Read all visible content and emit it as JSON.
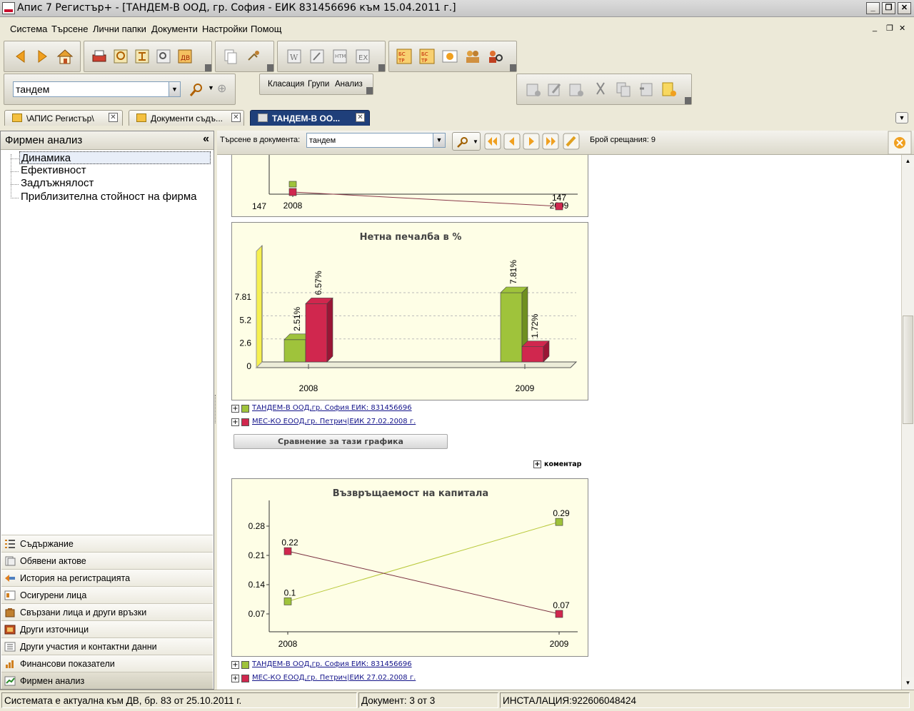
{
  "window": {
    "title": "Апис 7 Регистър+ - [ТАНДЕМ-В ООД, гр. София - ЕИК 831456696 към  15.04.2011 г.]"
  },
  "menu": [
    "Система",
    "Търсене",
    "Лични папки",
    "Документи",
    "Настройки",
    "Помощ"
  ],
  "toolbar": {
    "search_value": "тандем",
    "group_buttons": [
      "Класация",
      "Групи",
      "Анализ"
    ]
  },
  "tabs": [
    {
      "label": "\\АПИС Регистър\\"
    },
    {
      "label": "Документи съдъ..."
    },
    {
      "label": "ТАНДЕМ-В ОО..."
    }
  ],
  "left_panel": {
    "title": "Фирмен анализ",
    "collapse": "«",
    "tree": [
      "Динамика",
      "Ефективност",
      "Задлъжнялост",
      "Приблизителна стойност на фирма"
    ],
    "nav": [
      "Съдържание",
      "Обявени актове",
      "История на регистрацията",
      "Осигурени лица",
      "Свързани лица и други връзки",
      "Други източници",
      "Други участия и контактни данни",
      "Финансови показатели",
      "Фирмен анализ"
    ]
  },
  "searchbar": {
    "label": "Търсене в документа:",
    "value": "тандем",
    "count_label": "Брой срещания: 9"
  },
  "legend": {
    "series1": "ТАНДЕМ-В ООД,гр. София ЕИК: 831456696",
    "series2": "МЕС-КО ЕООД,гр. Петрич|ЕИК 27.02.2008 г.",
    "compare_button": "Сравнение за тази графика",
    "comment": "коментар"
  },
  "colors": {
    "series1": "#9fc33b",
    "series2": "#d0274e",
    "titlebar": "#1f3f7a"
  },
  "chart_data": [
    {
      "type": "line",
      "title": "",
      "categories": [
        "2008",
        "2009"
      ],
      "yticks": [
        "147"
      ],
      "point_labels": [
        "147",
        "147"
      ],
      "series": [
        {
          "values": [
            150,
            null
          ]
        },
        {
          "values": [
            149,
            147
          ]
        }
      ]
    },
    {
      "type": "bar",
      "title": "Нетна печалба в %",
      "categories": [
        "2008",
        "2009"
      ],
      "yticks": [
        "0",
        "2.6",
        "5.2",
        "7.81"
      ],
      "ylim": [
        0,
        7.81
      ],
      "series": [
        {
          "values": [
            2.51,
            7.81
          ],
          "labels": [
            "2.51%",
            "7.81%"
          ]
        },
        {
          "values": [
            6.57,
            1.72
          ],
          "labels": [
            "6.57%",
            "1.72%"
          ]
        }
      ]
    },
    {
      "type": "line",
      "title": "Възвръщаемост на капитала",
      "categories": [
        "2008",
        "2009"
      ],
      "yticks": [
        "0.07",
        "0.14",
        "0.21",
        "0.28"
      ],
      "series": [
        {
          "values": [
            0.1,
            0.29
          ],
          "labels": [
            "0.1",
            "0.29"
          ]
        },
        {
          "values": [
            0.22,
            0.07
          ],
          "labels": [
            "0.22",
            "0.07"
          ]
        }
      ]
    }
  ],
  "status": {
    "left": "Системата е актуална към ДВ, бр. 83 от 25.10.2011 г.",
    "doc": "Документ: 3 от 3",
    "install": "ИНСТАЛАЦИЯ:922606048424"
  }
}
